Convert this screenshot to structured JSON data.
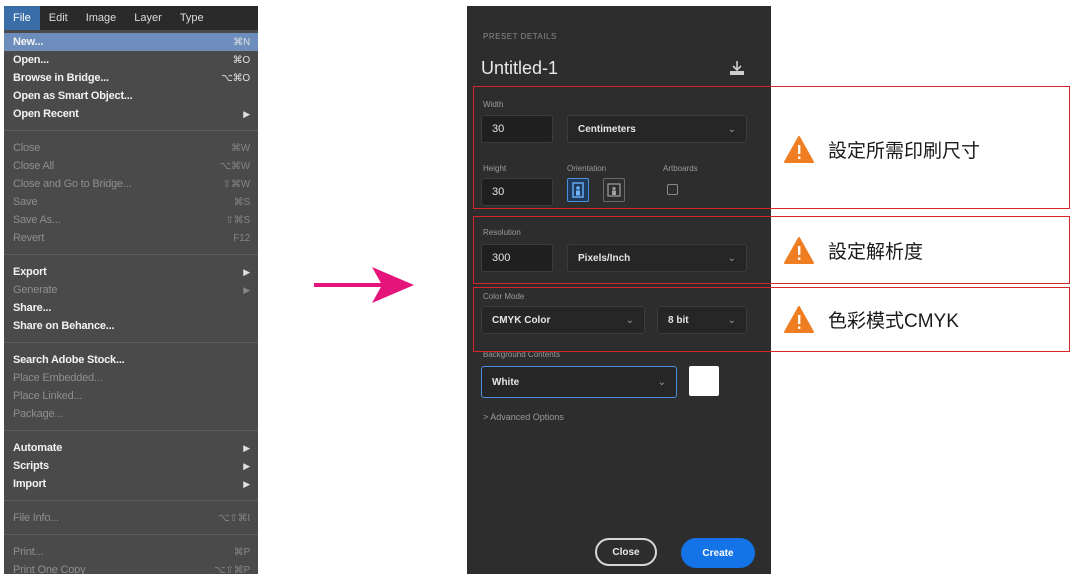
{
  "menubar": [
    "File",
    "Edit",
    "Image",
    "Layer",
    "Type"
  ],
  "menu_groups": [
    [
      {
        "label": "New...",
        "shortcut": "⌘N",
        "state": "highlighted"
      },
      {
        "label": "Open...",
        "shortcut": "⌘O",
        "state": "enabled"
      },
      {
        "label": "Browse in Bridge...",
        "shortcut": "⌥⌘O",
        "state": "enabled"
      },
      {
        "label": "Open as Smart Object...",
        "shortcut": "",
        "state": "enabled"
      },
      {
        "label": "Open Recent",
        "shortcut": "▶",
        "state": "enabled"
      }
    ],
    [
      {
        "label": "Close",
        "shortcut": "⌘W",
        "state": "disabled"
      },
      {
        "label": "Close All",
        "shortcut": "⌥⌘W",
        "state": "disabled"
      },
      {
        "label": "Close and Go to Bridge...",
        "shortcut": "⇧⌘W",
        "state": "disabled"
      },
      {
        "label": "Save",
        "shortcut": "⌘S",
        "state": "disabled"
      },
      {
        "label": "Save As...",
        "shortcut": "⇧⌘S",
        "state": "disabled"
      },
      {
        "label": "Revert",
        "shortcut": "F12",
        "state": "disabled"
      }
    ],
    [
      {
        "label": "Export",
        "shortcut": "▶",
        "state": "enabled"
      },
      {
        "label": "Generate",
        "shortcut": "▶",
        "state": "disabled"
      },
      {
        "label": "Share...",
        "shortcut": "",
        "state": "enabled"
      },
      {
        "label": "Share on Behance...",
        "shortcut": "",
        "state": "enabled"
      }
    ],
    [
      {
        "label": "Search Adobe Stock...",
        "shortcut": "",
        "state": "enabled"
      },
      {
        "label": "Place Embedded...",
        "shortcut": "",
        "state": "disabled"
      },
      {
        "label": "Place Linked...",
        "shortcut": "",
        "state": "disabled"
      },
      {
        "label": "Package...",
        "shortcut": "",
        "state": "disabled"
      }
    ],
    [
      {
        "label": "Automate",
        "shortcut": "▶",
        "state": "enabled"
      },
      {
        "label": "Scripts",
        "shortcut": "▶",
        "state": "enabled"
      },
      {
        "label": "Import",
        "shortcut": "▶",
        "state": "enabled"
      }
    ],
    [
      {
        "label": "File Info...",
        "shortcut": "⌥⇧⌘I",
        "state": "disabled"
      }
    ],
    [
      {
        "label": "Print...",
        "shortcut": "⌘P",
        "state": "disabled"
      },
      {
        "label": "Print One Copy",
        "shortcut": "⌥⇧⌘P",
        "state": "disabled"
      }
    ]
  ],
  "dialog": {
    "section_label": "PRESET DETAILS",
    "title": "Untitled-1",
    "width_label": "Width",
    "width_value": "30",
    "width_unit": "Centimeters",
    "height_label": "Height",
    "height_value": "30",
    "orientation_label": "Orientation",
    "artboards_label": "Artboards",
    "resolution_label": "Resolution",
    "resolution_value": "300",
    "resolution_unit": "Pixels/Inch",
    "color_mode_label": "Color Mode",
    "color_mode_value": "CMYK Color",
    "bit_depth_value": "8 bit",
    "background_label": "Background Contents",
    "background_value": "White",
    "advanced_label": "> Advanced Options",
    "close_label": "Close",
    "create_label": "Create"
  },
  "annotations": {
    "size": "設定所需印刷尺寸",
    "resolution": "設定解析度",
    "color_mode": "色彩模式CMYK"
  },
  "colors": {
    "accent_blue": "#1473e6",
    "annotation_red": "#d7252b",
    "warning_orange": "#ef7d22",
    "arrow_magenta": "#e4147b"
  }
}
